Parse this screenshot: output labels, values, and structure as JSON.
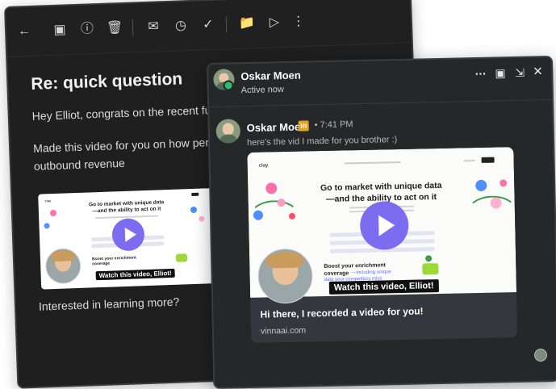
{
  "email": {
    "toolbar_icons": [
      "back-arrow-icon",
      "archive-icon",
      "report-spam-icon",
      "delete-icon",
      "mark-unread-icon",
      "snooze-icon",
      "add-task-icon",
      "move-to-icon",
      "label-icon",
      "more-vert-icon"
    ],
    "subject": "Re: quick question",
    "greeting": "Hey Elliot, congrats on the recent fu",
    "line2_a": "Made this video for you on how pers",
    "line2_b": "outbound revenue",
    "closing": "Interested in learning more?",
    "thumb_caption": "Watch this video, Elliot!",
    "thumb_headline_1": "Go to market with unique data",
    "thumb_headline_2": "—and the ability to act on it",
    "thumb_boost": "Boost your enrichment coverage"
  },
  "chat": {
    "contact_name": "Oskar Moen",
    "status": "Active now",
    "header_icons": [
      "more-horiz-icon",
      "video-call-icon",
      "collapse-icon",
      "close-icon"
    ],
    "message": {
      "sender": "Oskar Moen",
      "badge": "in",
      "time": "• 7:41 PM",
      "text": "here's the vid I made for you brother :)"
    },
    "card": {
      "title": "Hi there, I recorded a video for you!",
      "url": "vinnaai.com",
      "caption": "Watch this video, Elliot!",
      "headline_1": "Go to market with unique data",
      "headline_2": "—and the ability to act on it",
      "boost_1": "Boost your enrichment",
      "boost_2": "coverage",
      "boost_3": "—including unique",
      "boost_4": "data your competitors miss",
      "logo": "clay"
    }
  },
  "colors": {
    "accent_play": "#7b6cf0",
    "online": "#27c06a",
    "linkedin_badge": "#e3a425"
  }
}
